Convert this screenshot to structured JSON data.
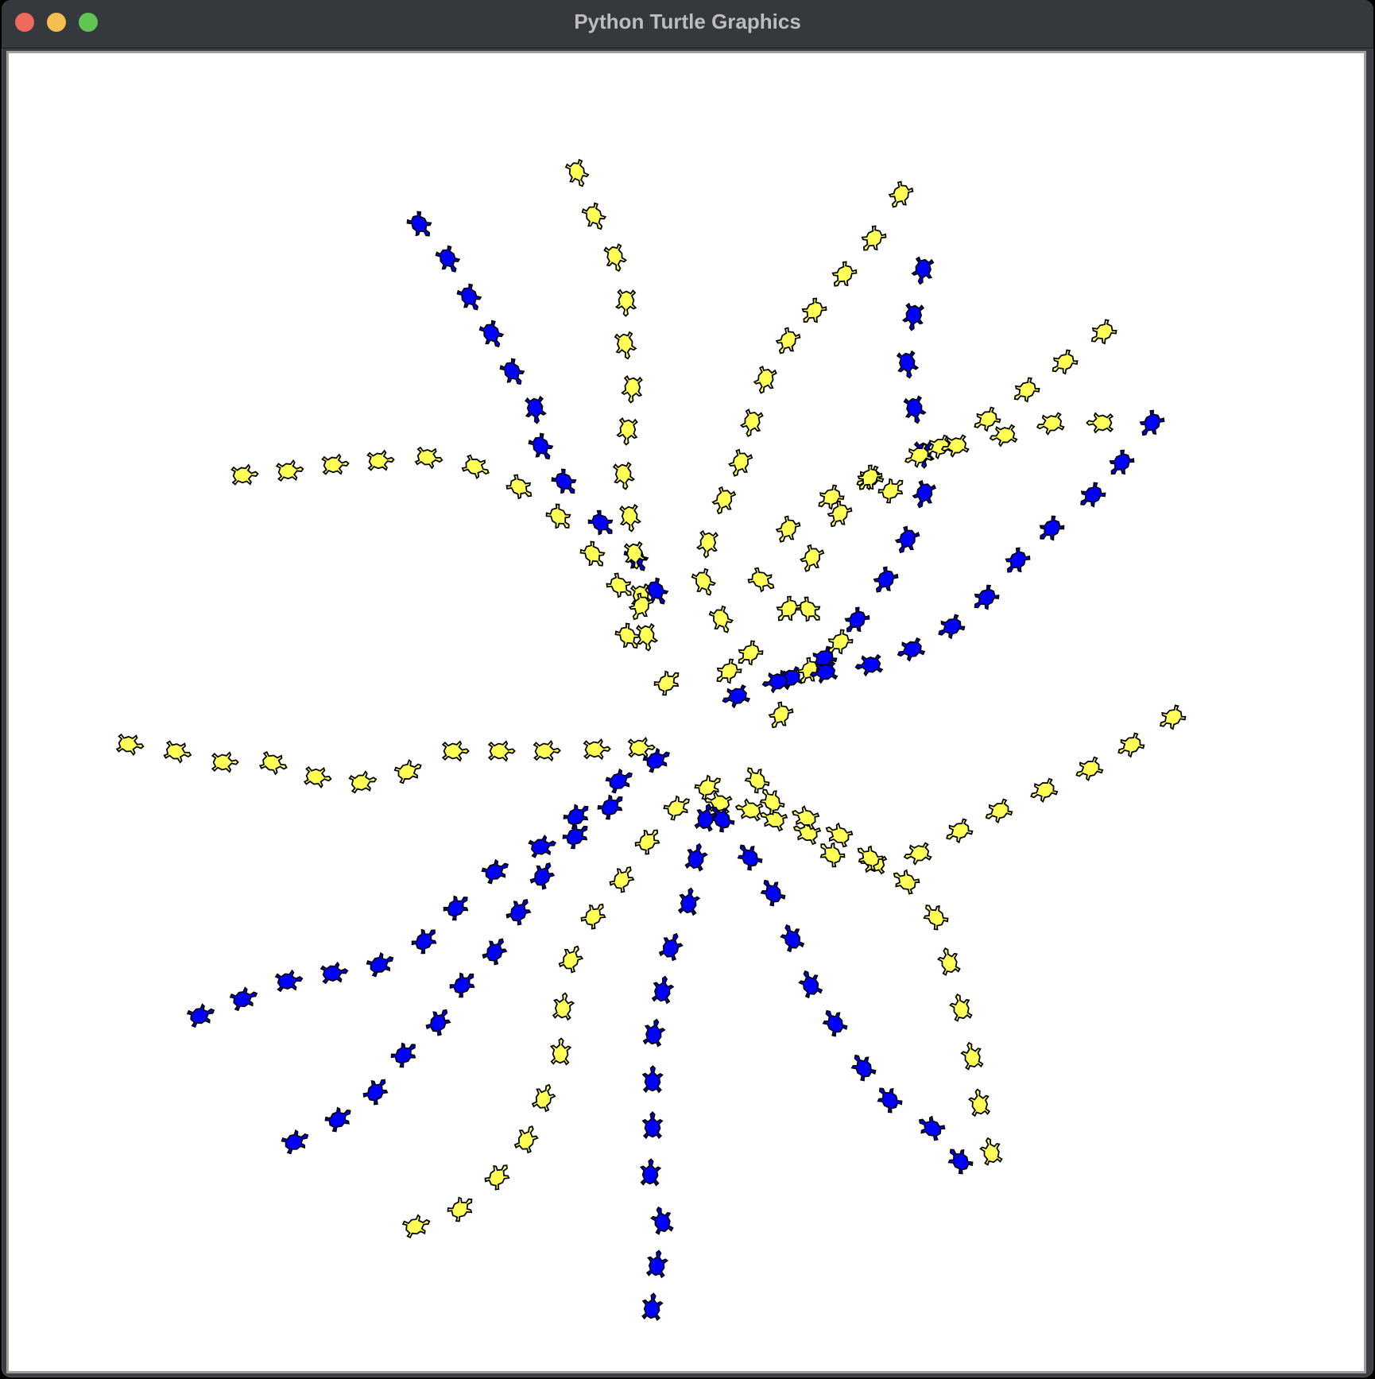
{
  "window": {
    "title": "Python Turtle Graphics"
  },
  "controls": {
    "close": "close-button",
    "minimize": "minimize-button",
    "maximize": "maximize-button"
  },
  "canvas": {
    "background": "#ffffff"
  },
  "colors": {
    "turtle_yellow": "#ffff55",
    "turtle_blue": "#0000ff",
    "outline": "#000000"
  },
  "drawing": {
    "shape": "turtle-icon",
    "arms": [
      {
        "name": "arm-blue-north-west",
        "color": "blue"
      },
      {
        "name": "arm-yellow-north",
        "color": "yellow"
      },
      {
        "name": "arm-yellow-north-east",
        "color": "yellow"
      },
      {
        "name": "arm-blue-north-east",
        "color": "blue"
      },
      {
        "name": "arm-yellow-east-upper",
        "color": "yellow"
      },
      {
        "name": "arm-blue-east",
        "color": "blue"
      },
      {
        "name": "arm-yellow-east-lower",
        "color": "yellow"
      },
      {
        "name": "arm-yellow-south-east",
        "color": "yellow"
      },
      {
        "name": "arm-blue-south-east",
        "color": "blue"
      },
      {
        "name": "arm-yellow-south-east-inner",
        "color": "yellow"
      },
      {
        "name": "arm-blue-south",
        "color": "blue"
      },
      {
        "name": "arm-yellow-south",
        "color": "yellow"
      },
      {
        "name": "arm-blue-south-west",
        "color": "blue"
      },
      {
        "name": "arm-blue-west",
        "color": "blue"
      },
      {
        "name": "arm-yellow-west",
        "color": "yellow"
      },
      {
        "name": "arm-yellow-north-west-loop",
        "color": "yellow"
      }
    ]
  }
}
